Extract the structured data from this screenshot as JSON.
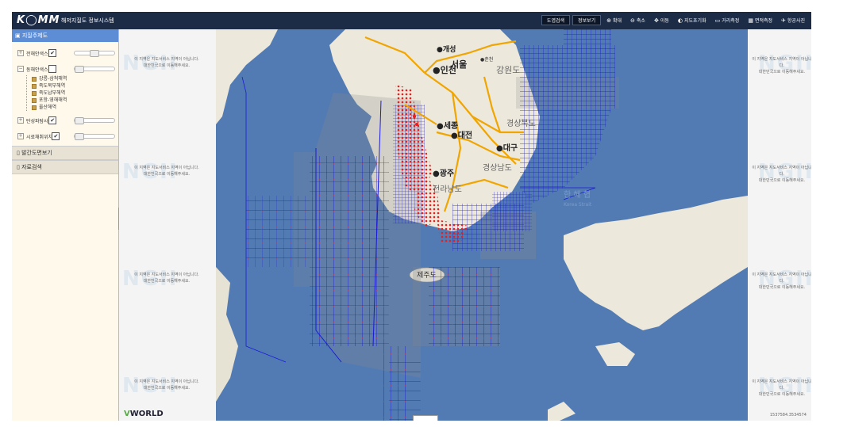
{
  "app": {
    "logo": "K◯MM",
    "subtitle": "해저지질도 정보시스템"
  },
  "toolbar": {
    "items": [
      {
        "label": "도엽검색",
        "icon": "",
        "boxed": true
      },
      {
        "label": "정보보기",
        "icon": "",
        "boxed": true
      },
      {
        "label": "확대",
        "icon": "⊕",
        "boxed": false
      },
      {
        "label": "축소",
        "icon": "⊖",
        "boxed": false
      },
      {
        "label": "이동",
        "icon": "✥",
        "boxed": false
      },
      {
        "label": "지도초기화",
        "icon": "◐",
        "boxed": false
      },
      {
        "label": "거리측정",
        "icon": "▭",
        "boxed": false
      },
      {
        "label": "면적측정",
        "icon": "▦",
        "boxed": false
      },
      {
        "label": "항공사진",
        "icon": "✈",
        "boxed": false
      }
    ]
  },
  "sidebar": {
    "header": "지질주제도",
    "layers": [
      {
        "label": "전해안색스캠",
        "checked": true,
        "toggle": "+",
        "slider": 0.5
      },
      {
        "label": "동해안색스캠",
        "checked": false,
        "toggle": "−",
        "slider": 0.0,
        "children": [
          "강릉-삼척해역",
          "죽도북부해역",
          "죽도남부해역",
          "포항-영해해역",
          "울산해역"
        ]
      },
      {
        "label": "탄성파탐사도",
        "checked": true,
        "toggle": "+",
        "slider": 0.0
      },
      {
        "label": "시료채취위치도",
        "checked": true,
        "toggle": "+",
        "slider": 0.0
      }
    ],
    "sections": [
      "발간도면보기",
      "자료검색"
    ]
  },
  "map": {
    "watermark_text": [
      "이 지역은 지도서비스 지역이 아닙니다.",
      "대한민국으로 이동해주세요."
    ],
    "watermark_logo": "NGII",
    "labels": {
      "kaesong": "●개성",
      "incheon": "●인천",
      "seoul": "서울",
      "gangwon": "강원도",
      "chuncheon": "●춘천",
      "sejong": "●세종",
      "daejeon": "●대전",
      "daegu": "●대구",
      "gyeongbuk": "경상북도",
      "gyeongnam": "경상남도",
      "gwangju": "●광주",
      "jeonnam": "전라남도",
      "jeju": "제주도",
      "east_sea": "한 해 협",
      "strait": "Korea Strait"
    },
    "vworld": {
      "v": "V",
      "rest": "WORLD"
    },
    "coord_readout": "1537584.3534574"
  },
  "colors": {
    "topbar": "#1c2b46",
    "sidebar_header": "#5d8dd5",
    "sea": "#5a7fb4",
    "land": "#ece8dc",
    "survey_lines": "#1a1ad8",
    "samples": "#e81e1e",
    "roads": "#f0a500"
  }
}
